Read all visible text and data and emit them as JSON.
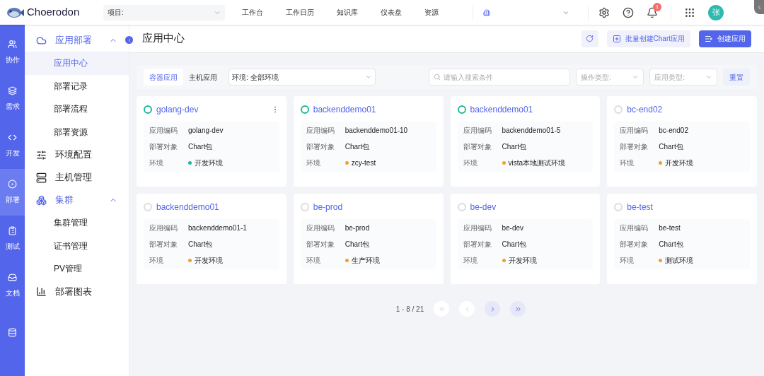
{
  "topbar": {
    "brand": "Choerodon",
    "project_select": {
      "label": "项目:"
    },
    "nav": [
      "工作台",
      "工作日历",
      "知识库",
      "仪表盘",
      "资源"
    ],
    "notification_count": "1",
    "avatar": "张"
  },
  "rail": [
    {
      "label": "协作",
      "selected": false
    },
    {
      "label": "需求",
      "selected": false
    },
    {
      "label": "开发",
      "selected": false
    },
    {
      "label": "部署",
      "selected": true
    },
    {
      "label": "测试",
      "selected": false
    },
    {
      "label": "文档",
      "selected": false
    },
    {
      "selected": false
    }
  ],
  "sidebar": {
    "items": [
      {
        "label": "应用部署",
        "expanded": true,
        "selected": false,
        "children": [
          {
            "label": "应用中心",
            "selected": true
          },
          {
            "label": "部署记录",
            "selected": false
          },
          {
            "label": "部署流程",
            "selected": false
          },
          {
            "label": "部署资源",
            "selected": false
          }
        ]
      },
      {
        "label": "环境配置",
        "selected": false
      },
      {
        "label": "主机管理",
        "selected": false
      },
      {
        "label": "集群",
        "expanded": true,
        "selected": false,
        "children": [
          {
            "label": "集群管理",
            "selected": false
          },
          {
            "label": "证书管理",
            "selected": false
          },
          {
            "label": "PV管理",
            "selected": false
          }
        ]
      },
      {
        "label": "部署图表",
        "selected": false
      }
    ]
  },
  "page": {
    "title": "应用中心",
    "buttons": [
      {
        "kind": "icon"
      },
      {
        "kind": "secondary",
        "label": "批量创建Chart应用"
      },
      {
        "kind": "primary",
        "label": "创建应用"
      }
    ]
  },
  "filters": {
    "tabs": [
      {
        "label": "容器应用",
        "selected": true
      },
      {
        "label": "主机应用",
        "selected": false
      }
    ],
    "env_select": "环境: 全部环境",
    "search": {
      "placeholder": "请输入搜索条件"
    },
    "op_type": {
      "placeholder": "操作类型:"
    },
    "app_type": {
      "placeholder": "应用类型:"
    },
    "reset": "重置"
  },
  "cards": [
    {
      "name": "golang-dev",
      "active": true,
      "menu": true,
      "fields": [
        {
          "label": "应用编码",
          "value": "golang-dev"
        },
        {
          "label": "部署对象",
          "value": "Chart包"
        },
        {
          "label": "环境",
          "value": "开发环境",
          "color": "#1fb89a"
        }
      ]
    },
    {
      "name": "backenddemo01",
      "active": true,
      "menu": false,
      "fields": [
        {
          "label": "应用编码",
          "value": "backenddemo01-10"
        },
        {
          "label": "部署对象",
          "value": "Chart包"
        },
        {
          "label": "环境",
          "value": "zcy-test",
          "color": "#f0a030"
        }
      ]
    },
    {
      "name": "backenddemo01",
      "active": true,
      "menu": false,
      "fields": [
        {
          "label": "应用编码",
          "value": "backenddemo01-5"
        },
        {
          "label": "部署对象",
          "value": "Chart包"
        },
        {
          "label": "环境",
          "value": "vista本地测试环境",
          "color": "#f0a030"
        }
      ]
    },
    {
      "name": "bc-end02",
      "active": false,
      "menu": false,
      "fields": [
        {
          "label": "应用编码",
          "value": "bc-end02"
        },
        {
          "label": "部署对象",
          "value": "Chart包"
        },
        {
          "label": "环境",
          "value": "开发环境",
          "color": "#f0a030"
        }
      ]
    },
    {
      "name": "backenddemo01",
      "active": false,
      "menu": false,
      "fields": [
        {
          "label": "应用编码",
          "value": "backenddemo01-1"
        },
        {
          "label": "部署对象",
          "value": "Chart包"
        },
        {
          "label": "环境",
          "value": "开发环境",
          "color": "#f0a030"
        }
      ]
    },
    {
      "name": "be-prod",
      "active": false,
      "menu": false,
      "fields": [
        {
          "label": "应用编码",
          "value": "be-prod"
        },
        {
          "label": "部署对象",
          "value": "Chart包"
        },
        {
          "label": "环境",
          "value": "生产环境",
          "color": "#f0a030"
        }
      ]
    },
    {
      "name": "be-dev",
      "active": false,
      "menu": false,
      "fields": [
        {
          "label": "应用编码",
          "value": "be-dev"
        },
        {
          "label": "部署对象",
          "value": "Chart包"
        },
        {
          "label": "环境",
          "value": "开发环境",
          "color": "#f0a030"
        }
      ]
    },
    {
      "name": "be-test",
      "active": false,
      "menu": false,
      "fields": [
        {
          "label": "应用编码",
          "value": "be-test"
        },
        {
          "label": "部署对象",
          "value": "Chart包"
        },
        {
          "label": "环境",
          "value": "测试环境",
          "color": "#f0a030"
        }
      ]
    }
  ],
  "pagination": {
    "range": "1 - 8 / 21",
    "first_disabled": true,
    "prev_disabled": true,
    "next_disabled": false,
    "last_disabled": false
  }
}
